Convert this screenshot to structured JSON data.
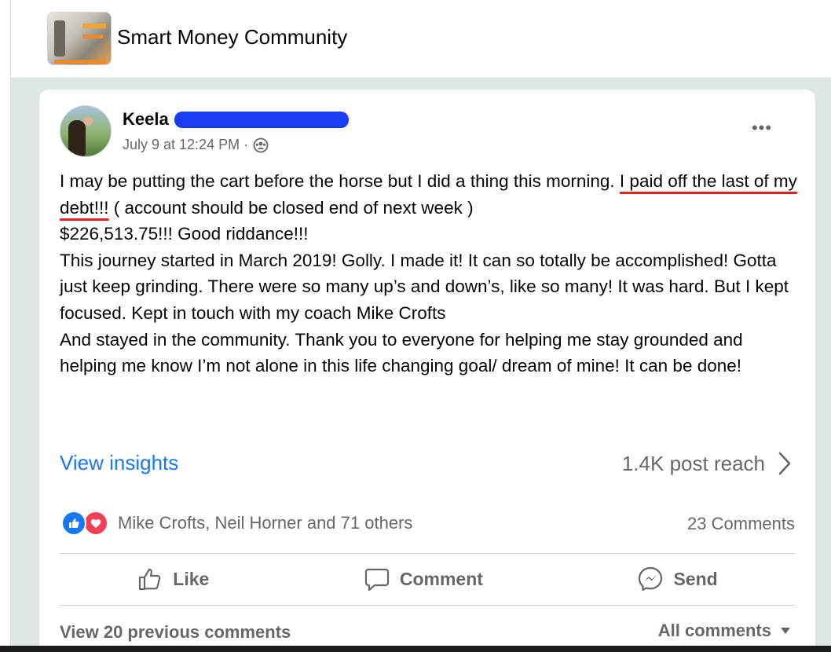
{
  "group": {
    "name": "Smart Money Community"
  },
  "post": {
    "author": "Keela",
    "timestamp": "July 9 at 12:24 PM · ",
    "more_label": "•••",
    "paragraphs": [
      {
        "before": "I may be putting the cart before the horse but I did a thing this morning. ",
        "highlight": "I paid off the last of my debt!!!",
        "after": " ( account should be closed end of next week )"
      },
      {
        "text": "$226,513.75!!! Good riddance!!!"
      },
      {
        "text": "This journey started in March 2019! Golly. I made it! It can so totally be accomplished! Gotta just keep grinding. There were so many up’s and down’s, like so many! It was hard. But I kept focused. Kept in touch with my coach Mike Crofts"
      },
      {
        "text": "And stayed in the community. Thank you to everyone for helping me stay grounded and helping me know I’m not alone in this life changing goal/ dream of mine! It can be done!"
      }
    ],
    "view_insights": "View insights",
    "post_reach": "1.4K post reach",
    "reactions_text": "Mike Crofts, Neil Horner and 71 others",
    "comments_count": "23 Comments",
    "actions": {
      "like": "Like",
      "comment": "Comment",
      "send": "Send"
    },
    "view_previous": "View 20 previous comments",
    "all_comments": "All comments"
  },
  "colors": {
    "accent": "#1877f2",
    "love": "#f33e58",
    "underline": "#e02424",
    "redact": "#1a3cf2"
  }
}
